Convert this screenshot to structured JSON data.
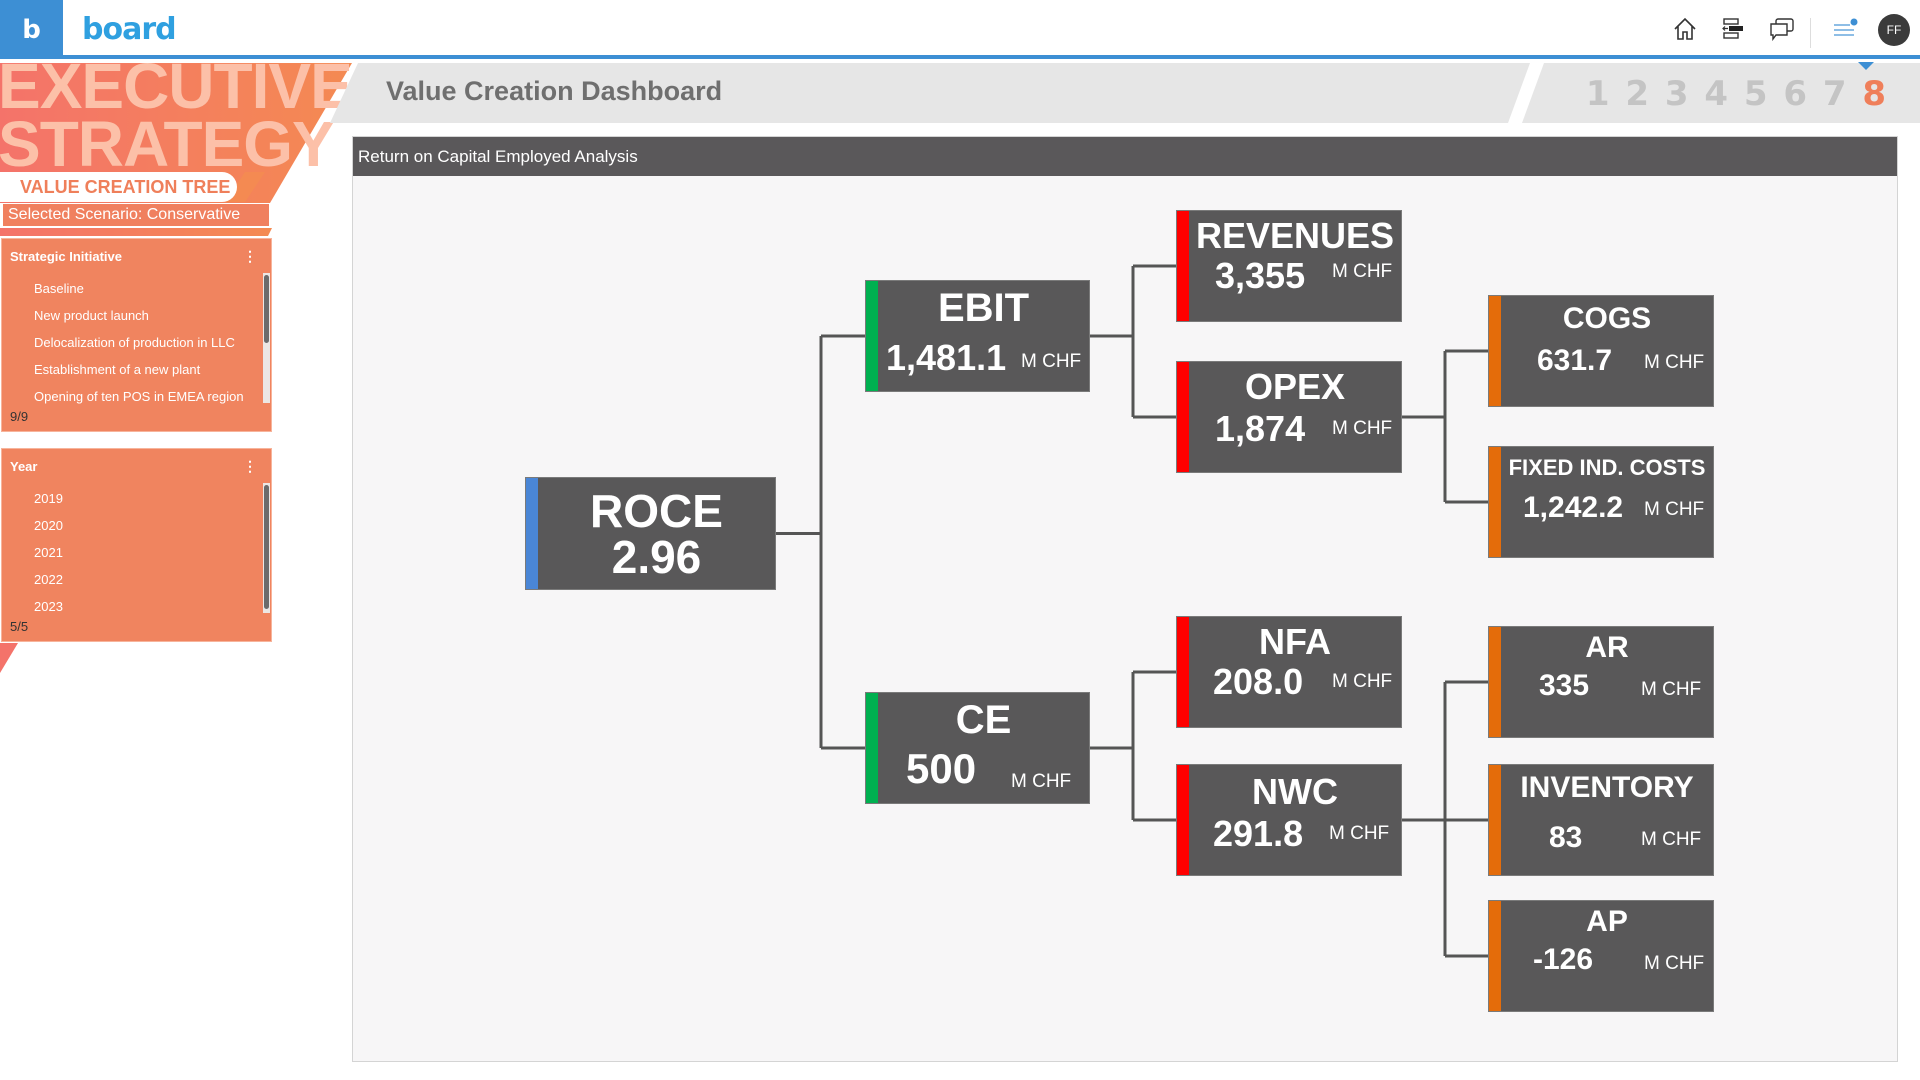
{
  "app": {
    "logo_letter": "b",
    "brand": "board",
    "user_initials": "FF"
  },
  "topbar": {
    "icons": [
      "home-icon",
      "navigation-icon",
      "comments-icon",
      "menu-notification-icon"
    ]
  },
  "banner": {
    "title_line1": "EXECUTIVE",
    "title_line2": "STRATEGY",
    "section": "VALUE CREATION TREE",
    "scenario": "Selected Scenario: Conservative"
  },
  "selectors": [
    {
      "title": "Strategic Initiative",
      "items": [
        "Baseline",
        "New product launch",
        "Delocalization of production in LLC",
        "Establishment of a new plant",
        "Opening of ten POS in EMEA region"
      ],
      "count": "9/9"
    },
    {
      "title": "Year",
      "items": [
        "2019",
        "2020",
        "2021",
        "2022",
        "2023"
      ],
      "count": "5/5"
    }
  ],
  "dashboard": {
    "title": "Value Creation Dashboard",
    "pages": [
      "1",
      "2",
      "3",
      "4",
      "5",
      "6",
      "7",
      "8"
    ],
    "active_page": "8"
  },
  "panel": {
    "title": "Return on Capital Employed Analysis"
  },
  "colors": {
    "accent_blue": "#3d8fd4",
    "accent_green": "#00b050",
    "accent_red": "#ff0000",
    "accent_orange": "#e46c0a",
    "brand_orange": "#ef7f5a"
  },
  "tree": {
    "unit": "M CHF",
    "nodes": [
      {
        "id": "roce",
        "label": "ROCE",
        "value": "2.96",
        "unit": "",
        "accent": "#4a86d6",
        "parent": null
      },
      {
        "id": "ebit",
        "label": "EBIT",
        "value": "1,481.1",
        "unit": "M CHF",
        "accent": "#00b050",
        "parent": "roce"
      },
      {
        "id": "ce",
        "label": "CE",
        "value": "500",
        "unit": "M CHF",
        "accent": "#00b050",
        "parent": "roce"
      },
      {
        "id": "revenues",
        "label": "REVENUES",
        "value": "3,355",
        "unit": "M CHF",
        "accent": "#ff0000",
        "parent": "ebit"
      },
      {
        "id": "opex",
        "label": "OPEX",
        "value": "1,874",
        "unit": "M CHF",
        "accent": "#ff0000",
        "parent": "ebit"
      },
      {
        "id": "cogs",
        "label": "COGS",
        "value": "631.7",
        "unit": "M CHF",
        "accent": "#e46c0a",
        "parent": "opex"
      },
      {
        "id": "fixed",
        "label": "FIXED IND. COSTS",
        "value": "1,242.2",
        "unit": "M CHF",
        "accent": "#e46c0a",
        "parent": "opex"
      },
      {
        "id": "nfa",
        "label": "NFA",
        "value": "208.0",
        "unit": "M CHF",
        "accent": "#ff0000",
        "parent": "ce"
      },
      {
        "id": "nwc",
        "label": "NWC",
        "value": "291.8",
        "unit": "M CHF",
        "accent": "#ff0000",
        "parent": "ce"
      },
      {
        "id": "ar",
        "label": "AR",
        "value": "335",
        "unit": "M CHF",
        "accent": "#e46c0a",
        "parent": "nwc"
      },
      {
        "id": "inventory",
        "label": "INVENTORY",
        "value": "83",
        "unit": "M CHF",
        "accent": "#e46c0a",
        "parent": "nwc"
      },
      {
        "id": "ap",
        "label": "AP",
        "value": "-126",
        "unit": "M CHF",
        "accent": "#e46c0a",
        "parent": "nwc"
      }
    ]
  }
}
